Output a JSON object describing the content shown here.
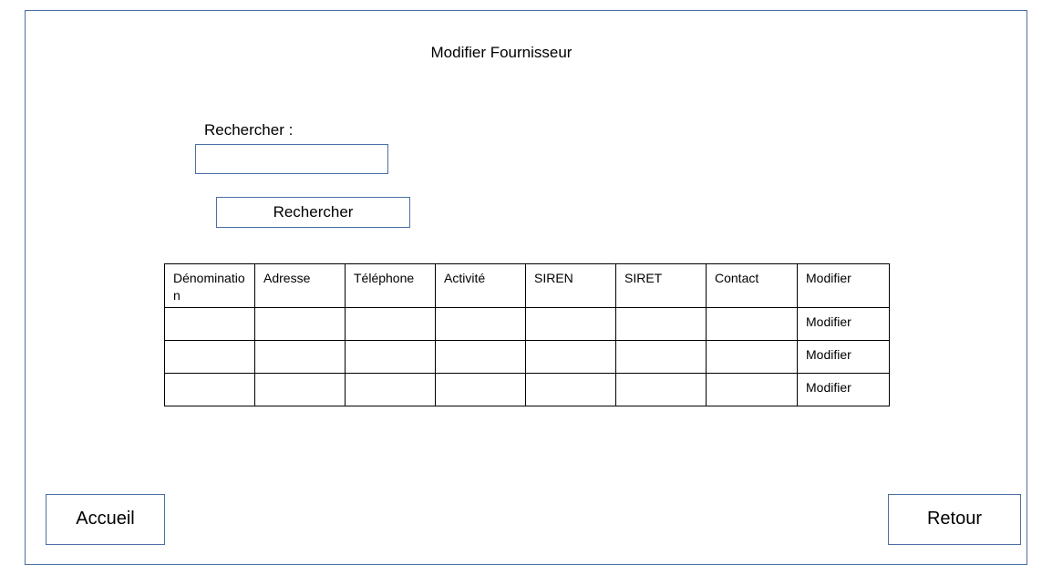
{
  "page": {
    "title": "Modifier Fournisseur"
  },
  "search": {
    "label": "Rechercher :",
    "value": "",
    "button_label": "Rechercher"
  },
  "table": {
    "headers": [
      "Dénomination",
      "Adresse",
      "Téléphone",
      "Activité",
      "SIREN",
      "SIRET",
      "Contact",
      "Modifier"
    ],
    "rows": [
      {
        "cells": [
          "",
          "",
          "",
          "",
          "",
          "",
          ""
        ],
        "action": "Modifier"
      },
      {
        "cells": [
          "",
          "",
          "",
          "",
          "",
          "",
          ""
        ],
        "action": "Modifier"
      },
      {
        "cells": [
          "",
          "",
          "",
          "",
          "",
          "",
          ""
        ],
        "action": "Modifier"
      }
    ]
  },
  "nav": {
    "home_label": "Accueil",
    "back_label": "Retour"
  },
  "colors": {
    "border_accent": "#4a6fa5",
    "table_border": "#000000"
  }
}
